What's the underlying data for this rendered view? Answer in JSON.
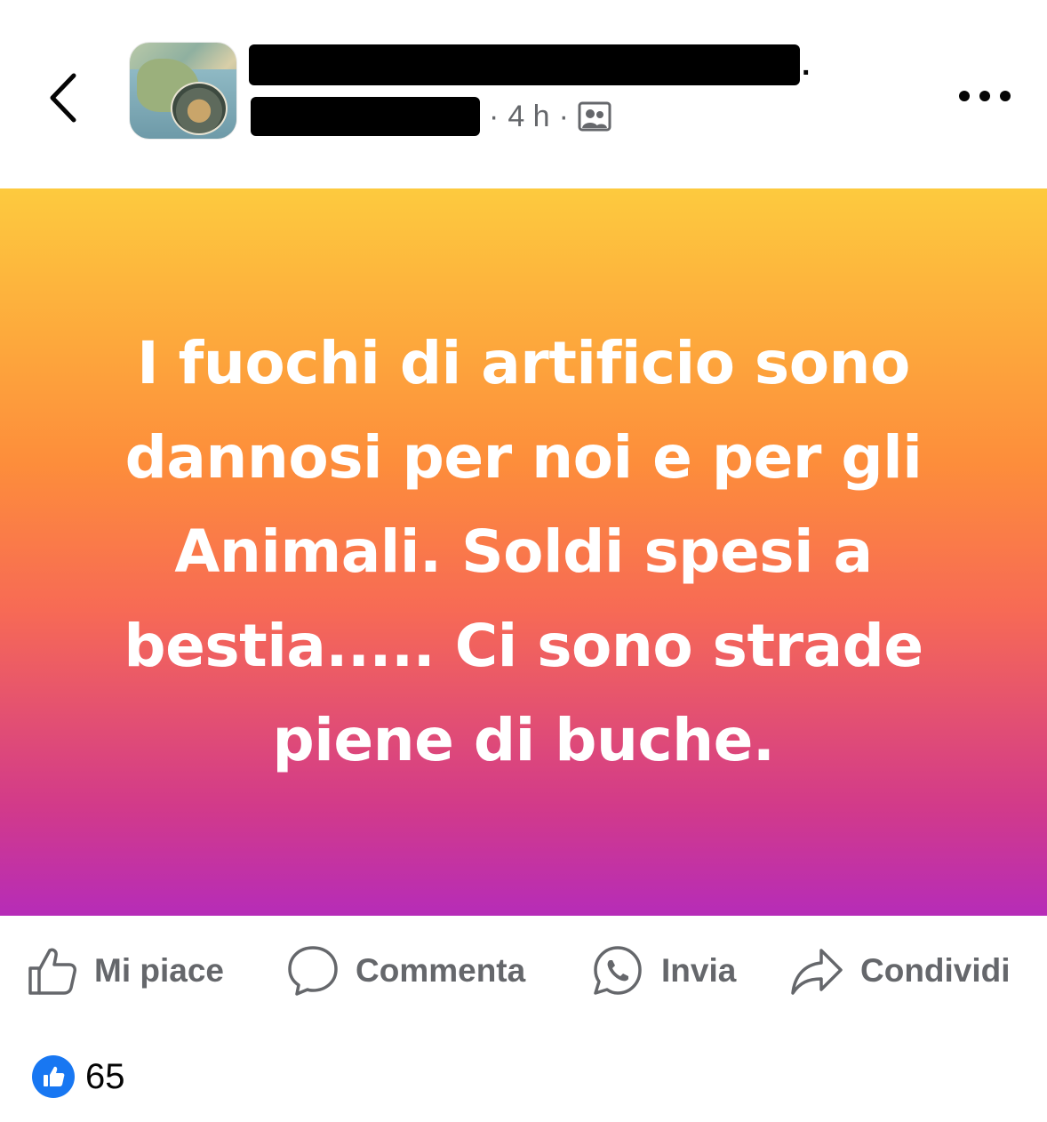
{
  "header": {
    "group_name_tail": ".",
    "time": "4 h",
    "separator": "·",
    "audience_icon": "group-icon"
  },
  "post": {
    "text": "I fuochi di artificio sono dannosi per noi e per gli Animali. Soldi spesi a bestia..... Ci sono strade piene di buche.",
    "gradient": [
      "#fdca3e",
      "#fd8d3b",
      "#f76a55",
      "#d23a8a",
      "#b62cb8"
    ]
  },
  "actions": {
    "like": "Mi piace",
    "comment": "Commenta",
    "send": "Invia",
    "share": "Condividi"
  },
  "reactions": {
    "count": "65",
    "accent": "#1877f2"
  }
}
